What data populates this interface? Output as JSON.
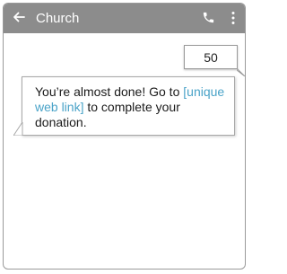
{
  "header": {
    "title": "Church",
    "back_icon": "back-arrow-icon",
    "call_icon": "phone-icon",
    "menu_icon": "more-vert-icon",
    "bar_color": "#8c8c8c"
  },
  "messages": {
    "outgoing": {
      "text": "50"
    },
    "incoming": {
      "text_before": "You’re almost done! Go to ",
      "link_text": "[unique web link]",
      "text_after": " to complete your donation."
    }
  },
  "colors": {
    "link": "#4aa3c8"
  }
}
